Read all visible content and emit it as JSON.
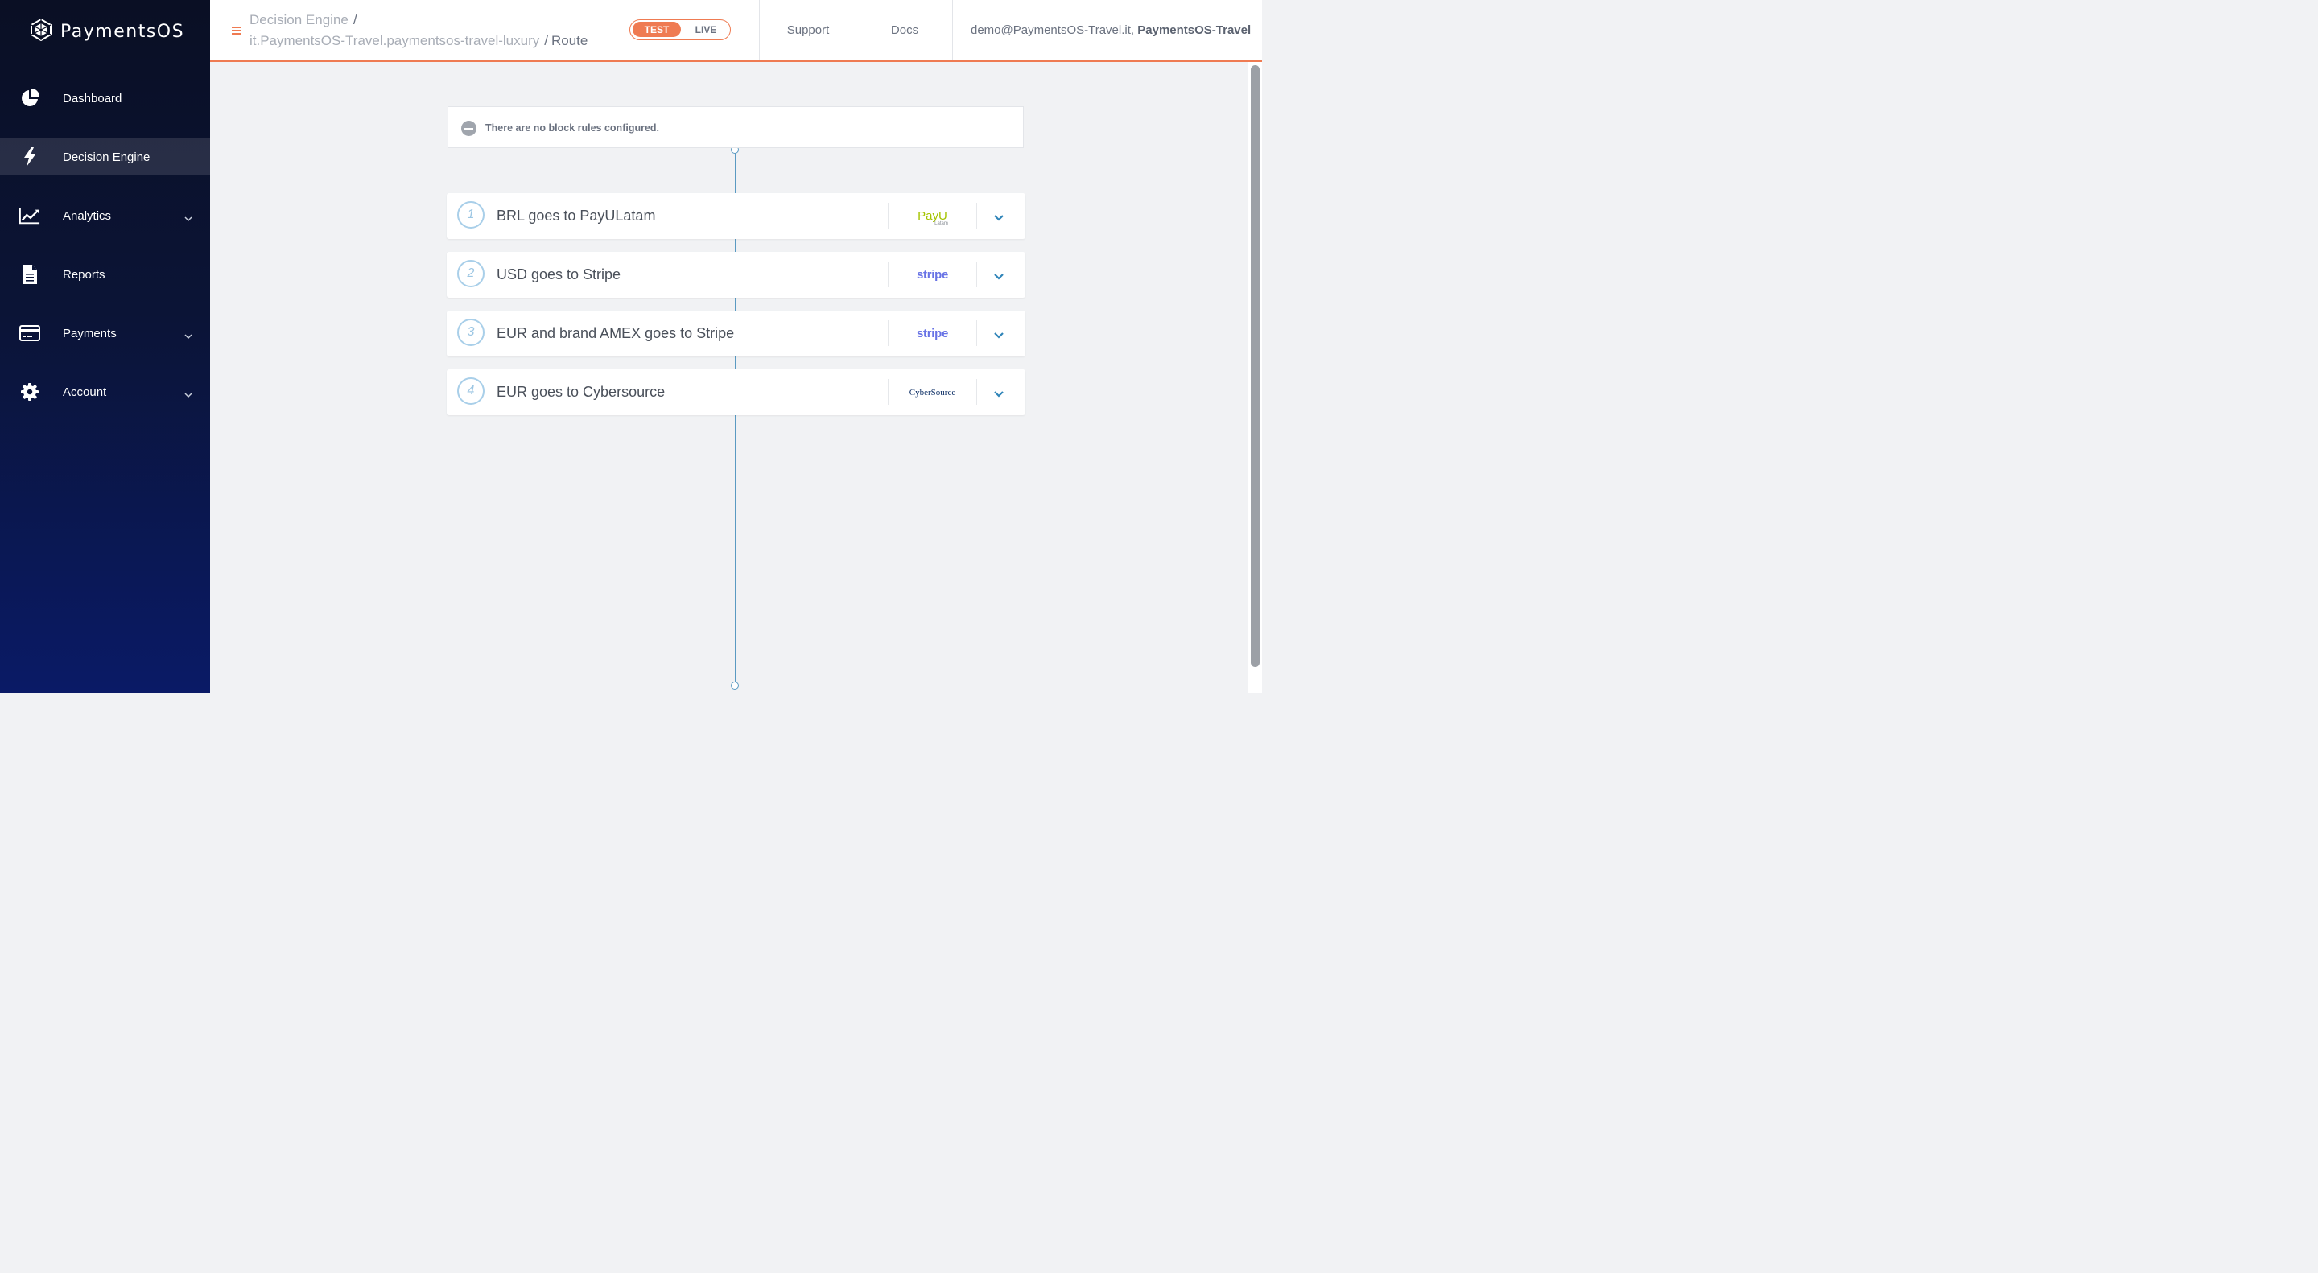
{
  "brand": {
    "name": "PaymentsOS",
    "accent": "#ef7b52",
    "link_blue": "#5a9ac2"
  },
  "sidebar": {
    "items": [
      {
        "label": "Dashboard",
        "icon": "pie-chart-icon",
        "active": false,
        "expandable": false
      },
      {
        "label": "Decision Engine",
        "icon": "lightning-icon",
        "active": true,
        "expandable": false
      },
      {
        "label": "Analytics",
        "icon": "line-chart-icon",
        "active": false,
        "expandable": true
      },
      {
        "label": "Reports",
        "icon": "document-icon",
        "active": false,
        "expandable": false
      },
      {
        "label": "Payments",
        "icon": "credit-card-icon",
        "active": false,
        "expandable": true
      },
      {
        "label": "Account",
        "icon": "gear-icon",
        "active": false,
        "expandable": true
      }
    ]
  },
  "header": {
    "breadcrumb": {
      "level1": "Decision Engine",
      "level2": "it.PaymentsOS-Travel.paymentsos-travel-luxury",
      "level3": "Route",
      "separator": "/"
    },
    "env": {
      "test_label": "TEST",
      "live_label": "LIVE",
      "selected": "TEST"
    },
    "support_label": "Support",
    "docs_label": "Docs",
    "user_email": "demo@PaymentsOS-Travel.it,",
    "user_org": "PaymentsOS-Travel"
  },
  "block_rules": {
    "message": "There are no block rules configured."
  },
  "rules": [
    {
      "number": "1",
      "title": "BRL goes to PayULatam",
      "provider": "PayU",
      "provider_sub": "Latam"
    },
    {
      "number": "2",
      "title": "USD goes to Stripe",
      "provider": "stripe",
      "provider_sub": ""
    },
    {
      "number": "3",
      "title": "EUR and brand AMEX goes to Stripe",
      "provider": "stripe",
      "provider_sub": ""
    },
    {
      "number": "4",
      "title": "EUR goes to Cybersource",
      "provider": "CyberSource",
      "provider_sub": ""
    }
  ]
}
